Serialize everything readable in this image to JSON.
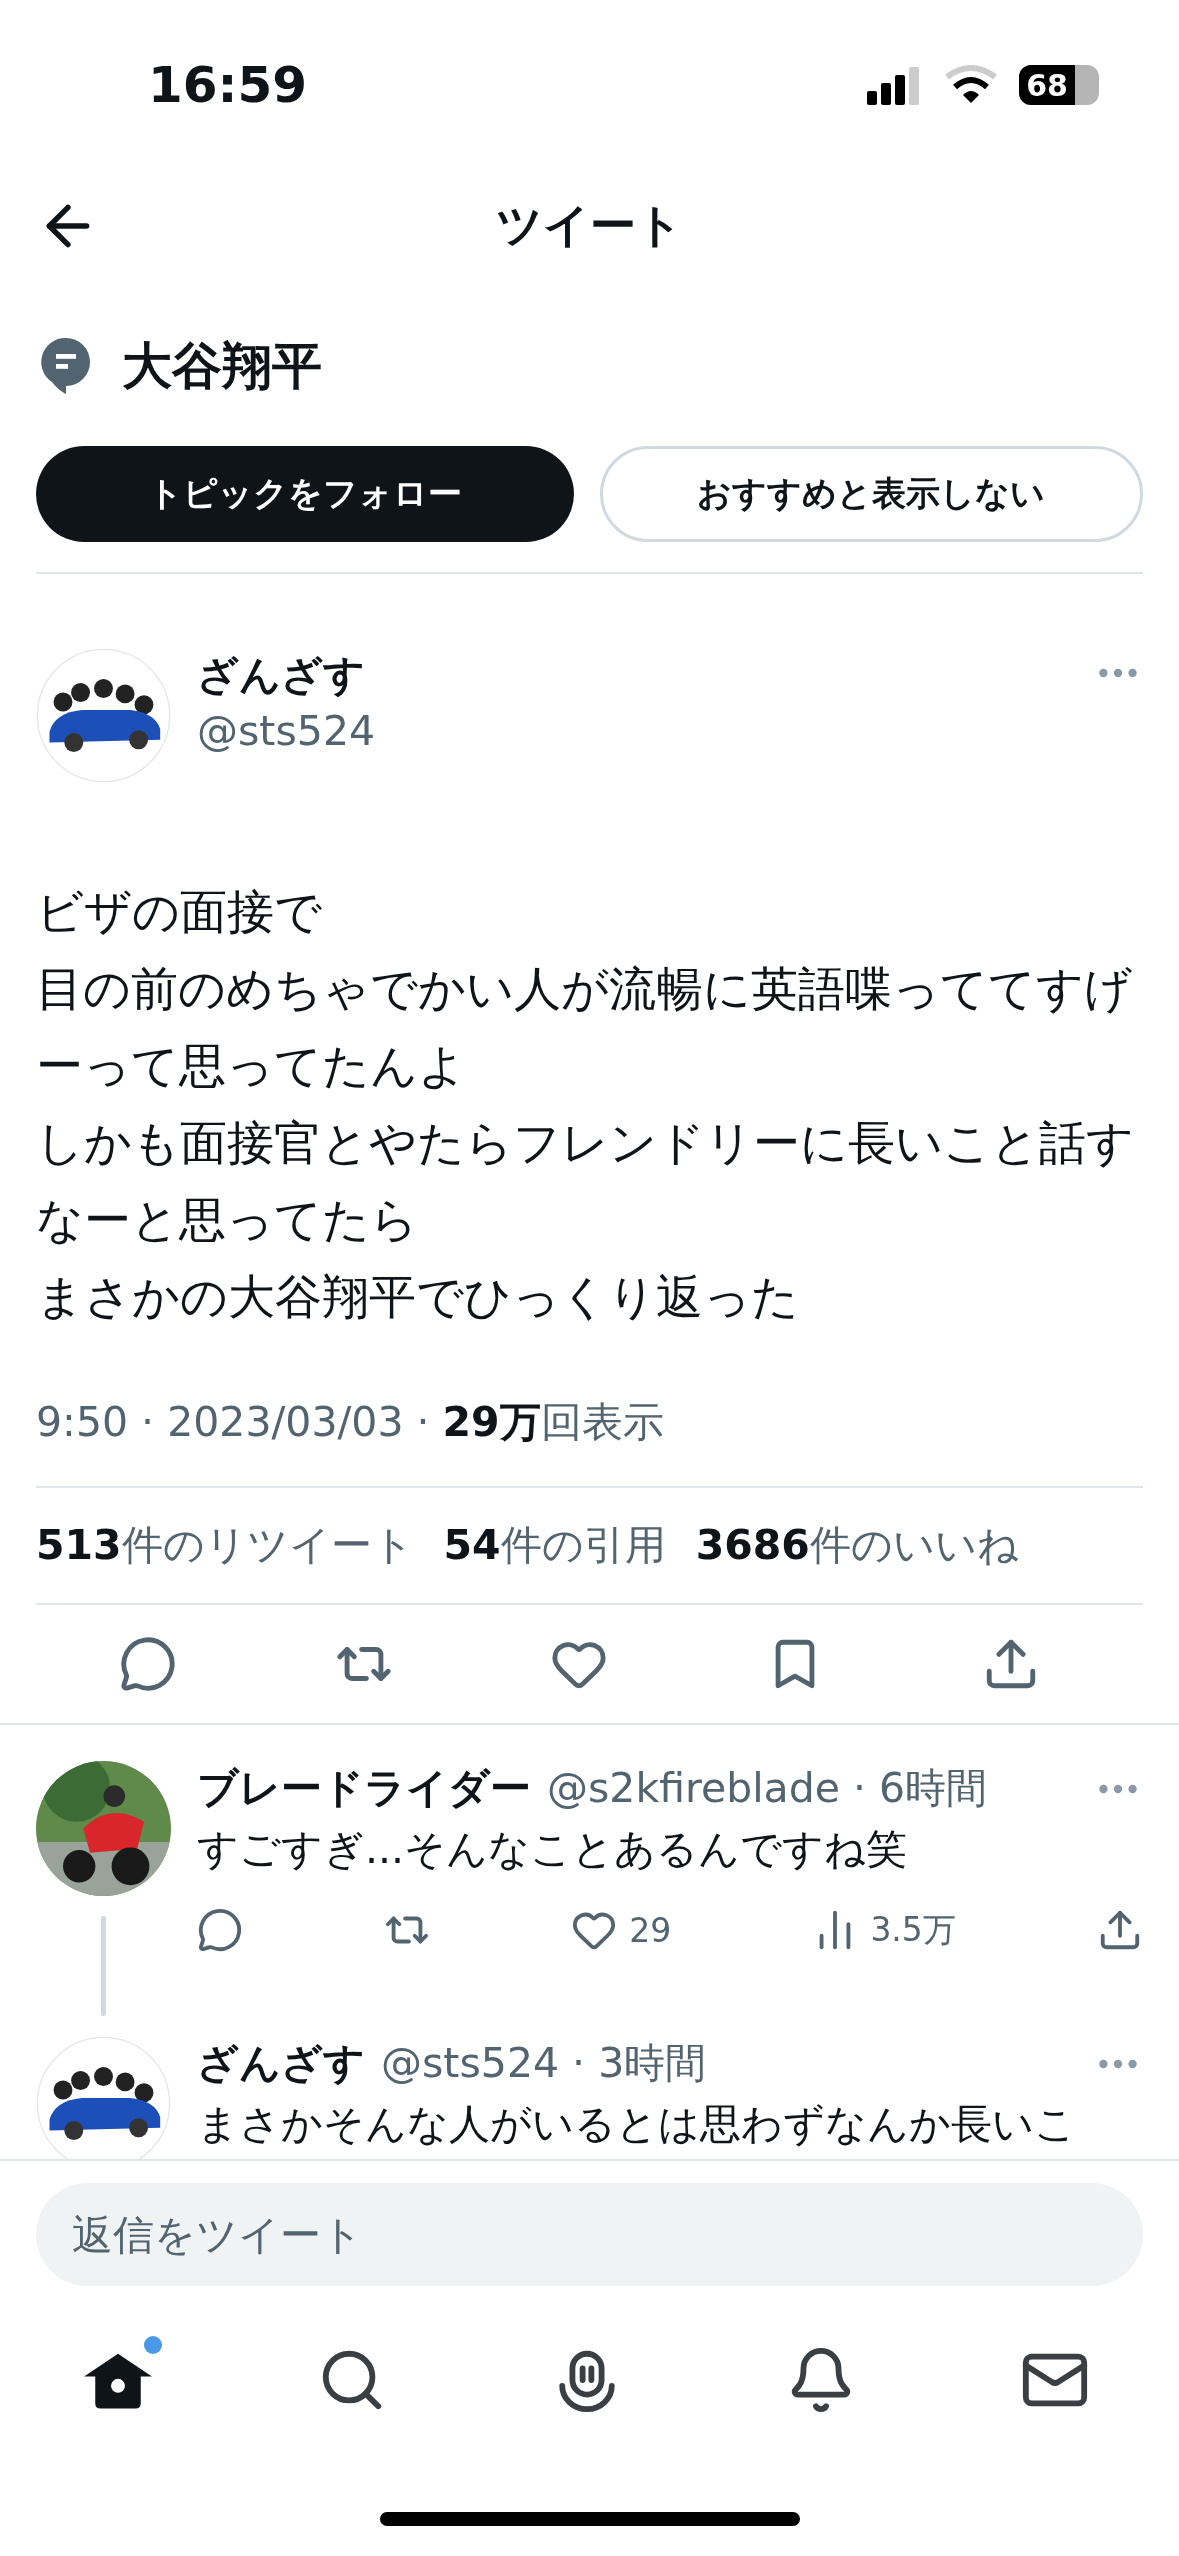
{
  "status_bar": {
    "time": "16:59",
    "battery": "68"
  },
  "header": {
    "title": "ツイート"
  },
  "topic": {
    "name": "大谷翔平",
    "buttons": [
      {
        "label": "トピックをフォロー",
        "kind": "primary"
      },
      {
        "label": "おすすめと表示しない",
        "kind": "outline"
      }
    ]
  },
  "tweet": {
    "author": {
      "name": "ざんざす",
      "handle": "@sts524"
    },
    "lines": [
      "ビザの面接で",
      "目の前のめちゃでかい人が流暢に英語喋っててすげーって思ってたんよ",
      "しかも面接官とやたらフレンドリーに長いこと話すなーと思ってたら",
      "まさかの大谷翔平でひっくり返った"
    ],
    "meta": "9:50 · 2023/03/03 · **29万**回表示",
    "stats": [
      "**513**件のリツイート",
      "**54**件の引用",
      "**3686**件のいいね"
    ]
  },
  "replies": [
    {
      "name": "ブレードライダー",
      "meta": "@s2kfireblade · 6時間",
      "text": "すごすぎ...そんなことあるんですね笑",
      "likes": "29",
      "views": "3.5万",
      "thread": true
    },
    {
      "name": "ざんざす",
      "meta": "@sts524 · 3時間",
      "text": "まさかそんな人がいるとは思わずなんか長いこ",
      "thread": false
    }
  ],
  "composer": {
    "placeholder": "返信をツイート"
  },
  "tab_bar": [
    {
      "kind": "home",
      "selected": true,
      "dot": true
    },
    {
      "kind": "search",
      "selected": false,
      "dot": false
    },
    {
      "kind": "spaces",
      "selected": false,
      "dot": false
    },
    {
      "kind": "notifications",
      "selected": false,
      "dot": false
    },
    {
      "kind": "messages",
      "selected": false,
      "dot": false
    }
  ]
}
